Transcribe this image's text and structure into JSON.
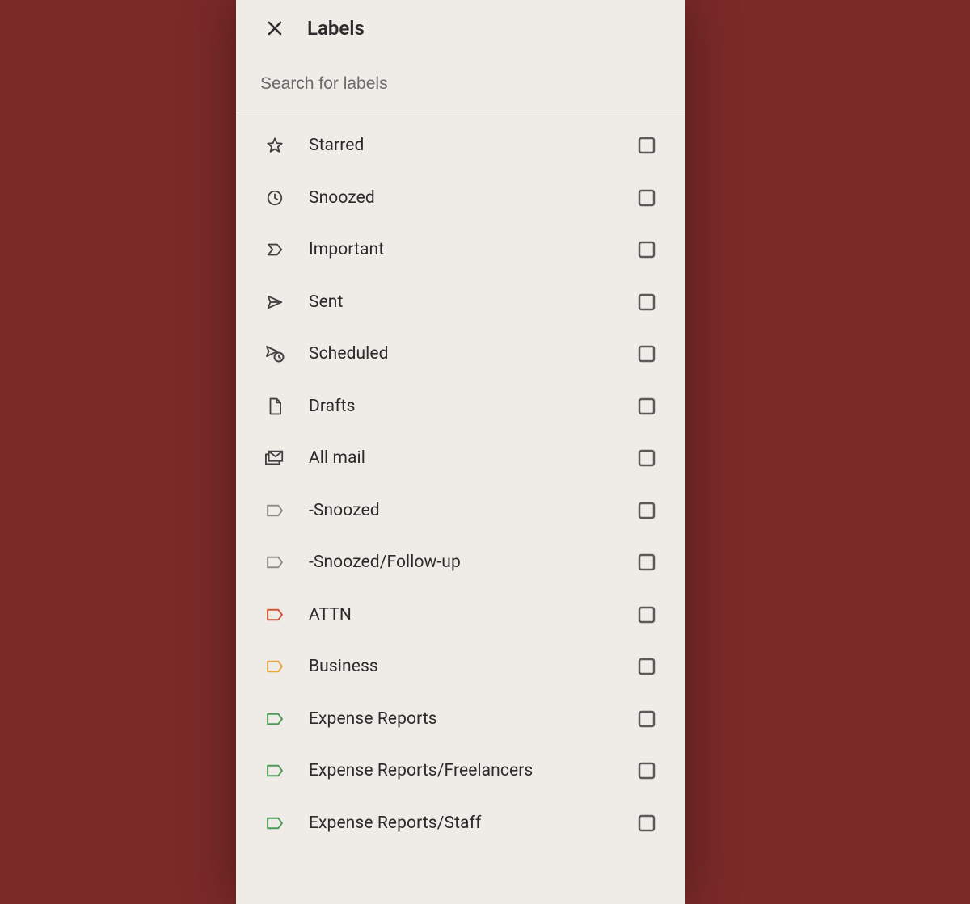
{
  "header": {
    "title": "Labels"
  },
  "search": {
    "placeholder": "Search for labels"
  },
  "colors": {
    "default": "#414141",
    "muted": "#8f8f8f",
    "red": "#d15236",
    "orange": "#e6a842",
    "green": "#4d9b58",
    "checkbox": "#5a5a5a"
  },
  "labels": [
    {
      "id": "starred",
      "icon": "star",
      "text": "Starred",
      "color": "default"
    },
    {
      "id": "snoozed",
      "icon": "clock",
      "text": "Snoozed",
      "color": "default"
    },
    {
      "id": "important",
      "icon": "important",
      "text": "Important",
      "color": "default"
    },
    {
      "id": "sent",
      "icon": "send",
      "text": "Sent",
      "color": "default"
    },
    {
      "id": "scheduled",
      "icon": "scheduled",
      "text": "Scheduled",
      "color": "default"
    },
    {
      "id": "drafts",
      "icon": "file",
      "text": "Drafts",
      "color": "default"
    },
    {
      "id": "allmail",
      "icon": "allmail",
      "text": "All mail",
      "color": "default"
    },
    {
      "id": "neg-snoozed",
      "icon": "label",
      "text": "-Snoozed",
      "color": "muted"
    },
    {
      "id": "neg-snoozed-followup",
      "icon": "label",
      "text": "-Snoozed/Follow-up",
      "color": "muted"
    },
    {
      "id": "attn",
      "icon": "label",
      "text": "ATTN",
      "color": "red"
    },
    {
      "id": "business",
      "icon": "label",
      "text": "Business",
      "color": "orange"
    },
    {
      "id": "expense-reports",
      "icon": "label",
      "text": "Expense Reports",
      "color": "green"
    },
    {
      "id": "expense-freelancers",
      "icon": "label",
      "text": "Expense Reports/Freelancers",
      "color": "green"
    },
    {
      "id": "expense-staff",
      "icon": "label",
      "text": "Expense Reports/Staff",
      "color": "green"
    }
  ]
}
